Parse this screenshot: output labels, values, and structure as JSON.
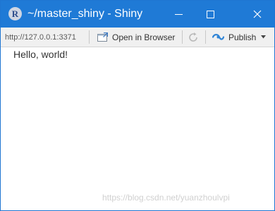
{
  "window": {
    "title": "~/master_shiny - Shiny",
    "app_icon": "R",
    "accent_color": "#1f7ad6"
  },
  "toolbar": {
    "url": "http://127.0.0.1:3371",
    "open_in_browser_label": "Open in Browser",
    "publish_label": "Publish",
    "icons": [
      "open-in-browser-icon",
      "refresh-icon",
      "publish-icon",
      "chevron-down-icon"
    ]
  },
  "content": {
    "text": "Hello, world!"
  },
  "watermark": "https://blog.csdn.net/yuanzhoulvpi"
}
